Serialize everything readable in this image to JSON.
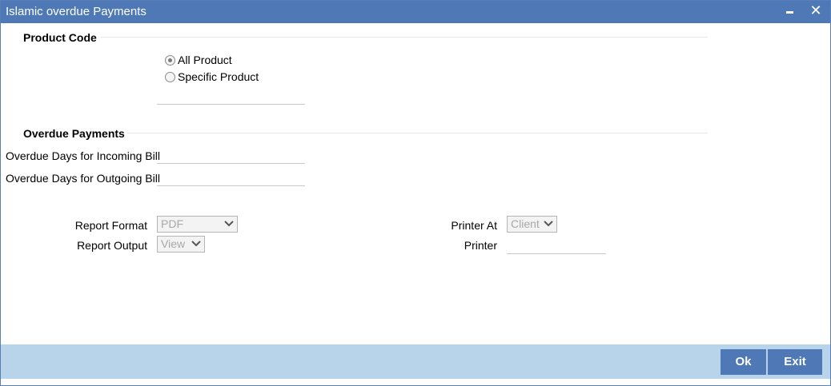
{
  "window": {
    "title": "Islamic overdue Payments",
    "minimize_icon": "minimize-icon",
    "close_icon": "close-icon",
    "close_glyph": "✕"
  },
  "product_code": {
    "heading": "Product Code",
    "options": [
      {
        "label": "All Product",
        "selected": true
      },
      {
        "label": "Specific Product",
        "selected": false
      }
    ],
    "product_value": ""
  },
  "overdue_payments": {
    "heading": "Overdue Payments",
    "incoming_label": "Overdue Days for Incoming Bill",
    "incoming_value": "",
    "outgoing_label": "Overdue Days for Outgoing Bill",
    "outgoing_value": ""
  },
  "report": {
    "format_label": "Report Format",
    "format_value": "PDF",
    "output_label": "Report Output",
    "output_value": "View",
    "printer_at_label": "Printer At",
    "printer_at_value": "Client",
    "printer_label": "Printer",
    "printer_value": ""
  },
  "footer": {
    "ok_label": "Ok",
    "exit_label": "Exit"
  },
  "colors": {
    "titlebar": "#4e79b6",
    "footer": "#b8d4ea",
    "button": "#4e79b6"
  }
}
